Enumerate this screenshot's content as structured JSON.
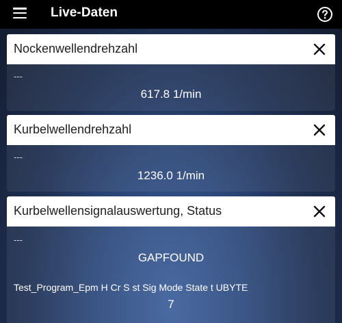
{
  "app": {
    "title": "Live-Daten",
    "menu_icon": "hamburger-menu-icon",
    "help_icon": "help-circle-icon"
  },
  "cards": [
    {
      "title": "Nockenwellendrehzahl",
      "sub_label": "---",
      "value": "617.8 1/min",
      "close_icon": "close-icon"
    },
    {
      "title": "Kurbelwellendrehzahl",
      "sub_label": "---",
      "value": "1236.0 1/min",
      "close_icon": "close-icon"
    },
    {
      "title": "Kurbelwellensignalauswertung, Status",
      "sub_label": "---",
      "value": "GAPFOUND",
      "detail_label": "Test_Program_Epm H Cr S st Sig Mode State t UBYTE",
      "detail_value": "7",
      "close_icon": "close-icon"
    }
  ]
}
